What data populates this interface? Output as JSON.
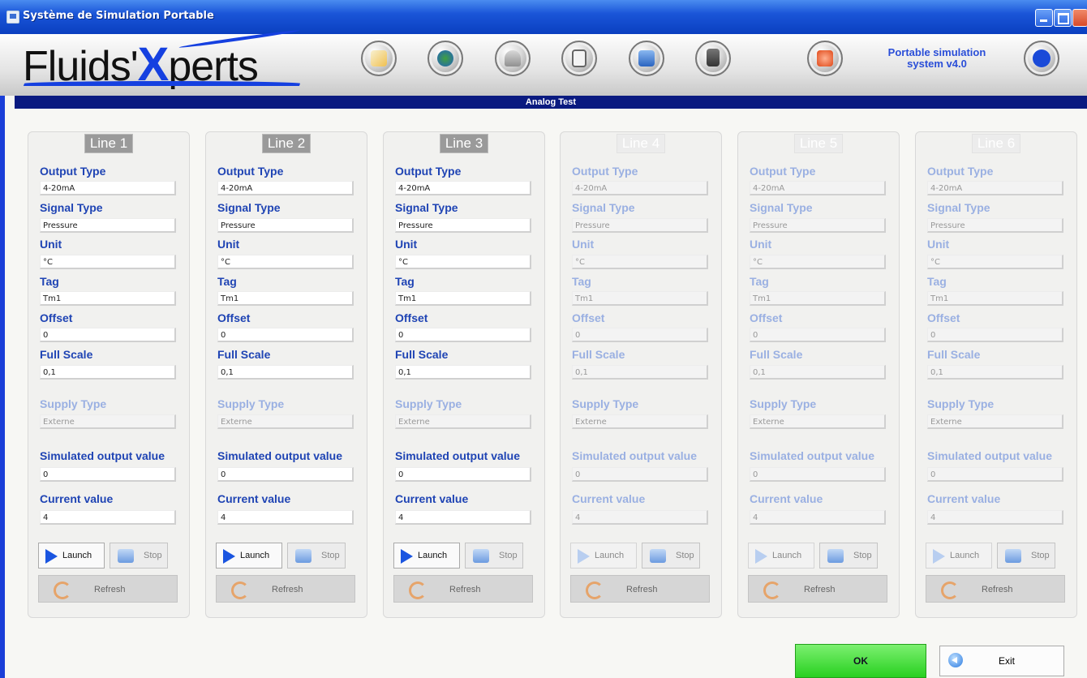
{
  "window": {
    "title": "Système de Simulation Portable"
  },
  "header": {
    "logo_part1": "Fluids'",
    "logo_x": "X",
    "logo_part2": "perts",
    "product_line1": "Portable simulation",
    "product_line2": "system v4.0",
    "toolbar_icons": [
      "edit-icon",
      "users-icon",
      "weight-icon",
      "device-icon",
      "network-icon",
      "calculator-icon",
      "power-icon",
      "app-logo-icon"
    ]
  },
  "section_title": "Analog Test",
  "field_labels": {
    "output_type": "Output Type",
    "signal_type": "Signal Type",
    "unit": "Unit",
    "tag": "Tag",
    "offset": "Offset",
    "full_scale": "Full Scale",
    "supply_type": "Supply Type",
    "simulated_output": "Simulated output value",
    "current_value": "Current value"
  },
  "buttons": {
    "launch": "Launch",
    "stop": "Stop",
    "refresh": "Refresh",
    "ok": "OK",
    "exit": "Exit"
  },
  "lines": [
    {
      "title": "Line 1",
      "enabled": true,
      "output_type": "4-20mA",
      "signal_type": "Pressure",
      "unit": "°C",
      "tag": "Tm1",
      "offset": "0",
      "full_scale": "0,1",
      "supply_type": "Externe",
      "simulated_output": "0",
      "current_value": "4"
    },
    {
      "title": "Line 2",
      "enabled": true,
      "output_type": "4-20mA",
      "signal_type": "Pressure",
      "unit": "°C",
      "tag": "Tm1",
      "offset": "0",
      "full_scale": "0,1",
      "supply_type": "Externe",
      "simulated_output": "0",
      "current_value": "4"
    },
    {
      "title": "Line 3",
      "enabled": true,
      "output_type": "4-20mA",
      "signal_type": "Pressure",
      "unit": "°C",
      "tag": "Tm1",
      "offset": "0",
      "full_scale": "0,1",
      "supply_type": "Externe",
      "simulated_output": "0",
      "current_value": "4"
    },
    {
      "title": "Line 4",
      "enabled": false,
      "output_type": "4-20mA",
      "signal_type": "Pressure",
      "unit": "°C",
      "tag": "Tm1",
      "offset": "0",
      "full_scale": "0,1",
      "supply_type": "Externe",
      "simulated_output": "0",
      "current_value": "4"
    },
    {
      "title": "Line 5",
      "enabled": false,
      "output_type": "4-20mA",
      "signal_type": "Pressure",
      "unit": "°C",
      "tag": "Tm1",
      "offset": "0",
      "full_scale": "0,1",
      "supply_type": "Externe",
      "simulated_output": "0",
      "current_value": "4"
    },
    {
      "title": "Line 6",
      "enabled": false,
      "output_type": "4-20mA",
      "signal_type": "Pressure",
      "unit": "°C",
      "tag": "Tm1",
      "offset": "0",
      "full_scale": "0,1",
      "supply_type": "Externe",
      "simulated_output": "0",
      "current_value": "4"
    }
  ],
  "colors": {
    "label_blue": "#1f44b4",
    "section_bar": "#0a1a80",
    "ok_green": "#28d020"
  }
}
